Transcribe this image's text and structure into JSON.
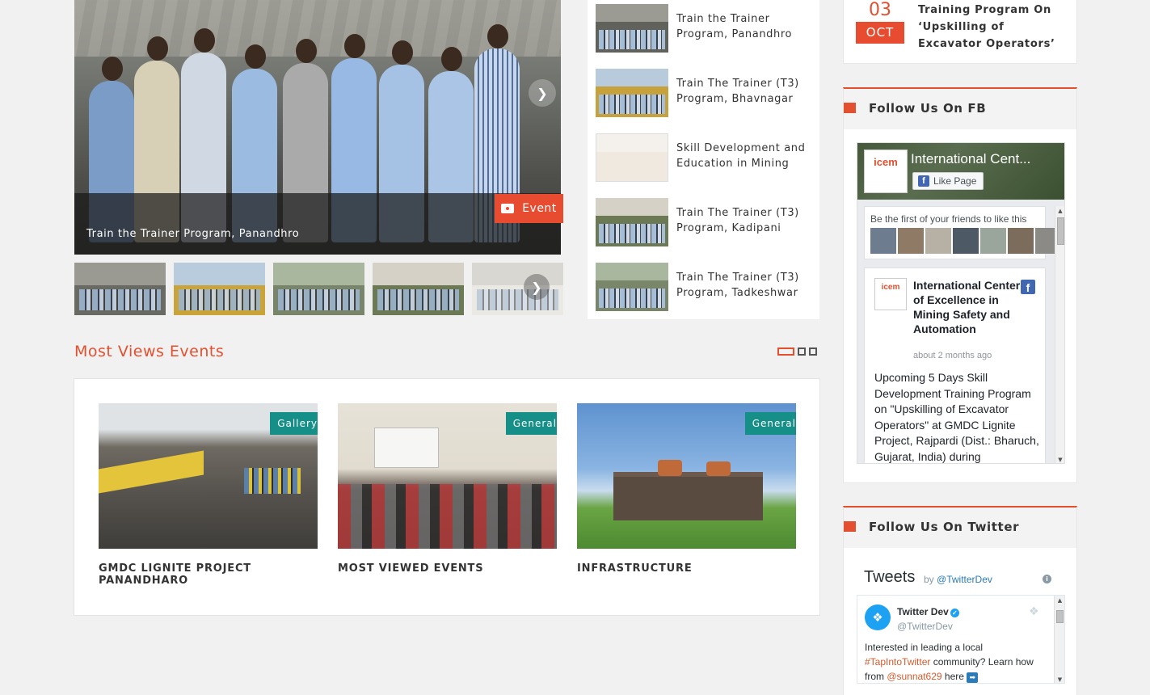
{
  "slider": {
    "caption": "Train the Trainer Program, Panandhro",
    "badge_label": "Event",
    "badge_icon": "camera-icon",
    "next_icon": "chevron-right-icon"
  },
  "news": [
    {
      "title": "Train the Trainer Program, Panandhro"
    },
    {
      "title": "Train The Trainer (T3) Program, Bhavnagar"
    },
    {
      "title": "Skill Development and Education in Mining"
    },
    {
      "title": "Train The Trainer (T3) Program, Kadipani"
    },
    {
      "title": "Train The Trainer (T3) Program, Tadkeshwar"
    }
  ],
  "most_views": {
    "title": "Most Views Events",
    "cards": [
      {
        "tag": "Gallery",
        "name": "GMDC LIGNITE PROJECT PANANDHARO"
      },
      {
        "tag": "General",
        "name": "MOST VIEWED EVENTS"
      },
      {
        "tag": "General",
        "name": "INFRASTRUCTURE"
      }
    ]
  },
  "upcoming": {
    "day": "03",
    "month": "OCT",
    "title": "Training Program On ‘Upskilling of Excavator Operators’"
  },
  "fb_widget": {
    "heading": "Follow Us On FB",
    "page_name": "International Cent...",
    "like_label": "Like Page",
    "friends_text": "Be the first of your friends to like this",
    "logo_text": "icem",
    "post_author": "International Center of Excellence in Mining Safety and Automation",
    "post_time": "about 2 months ago",
    "post_text": "Upcoming 5 Days Skill Development Training Program on \"Upskilling of Excavator Operators\" at GMDC Lignite Project, Rajpardi (Dist.: Bharuch, Gujarat, India) during"
  },
  "twitter_widget": {
    "heading": "Follow Us On Twitter",
    "title": "Tweets",
    "by": "by",
    "by_handle": "@TwitterDev",
    "info_icon": "i",
    "author_name": "Twitter Dev",
    "author_handle": "@TwitterDev",
    "text_1": "Interested in leading a local",
    "hashtag": "#TapIntoTwitter",
    "text_2": " community? Learn how from ",
    "mention": "@sunnat629",
    "text_3": " here "
  },
  "colors": {
    "accent": "#e2502f",
    "teal_tag": "#168f88",
    "facebook": "#4267b2",
    "twitter": "#1da1f2"
  }
}
